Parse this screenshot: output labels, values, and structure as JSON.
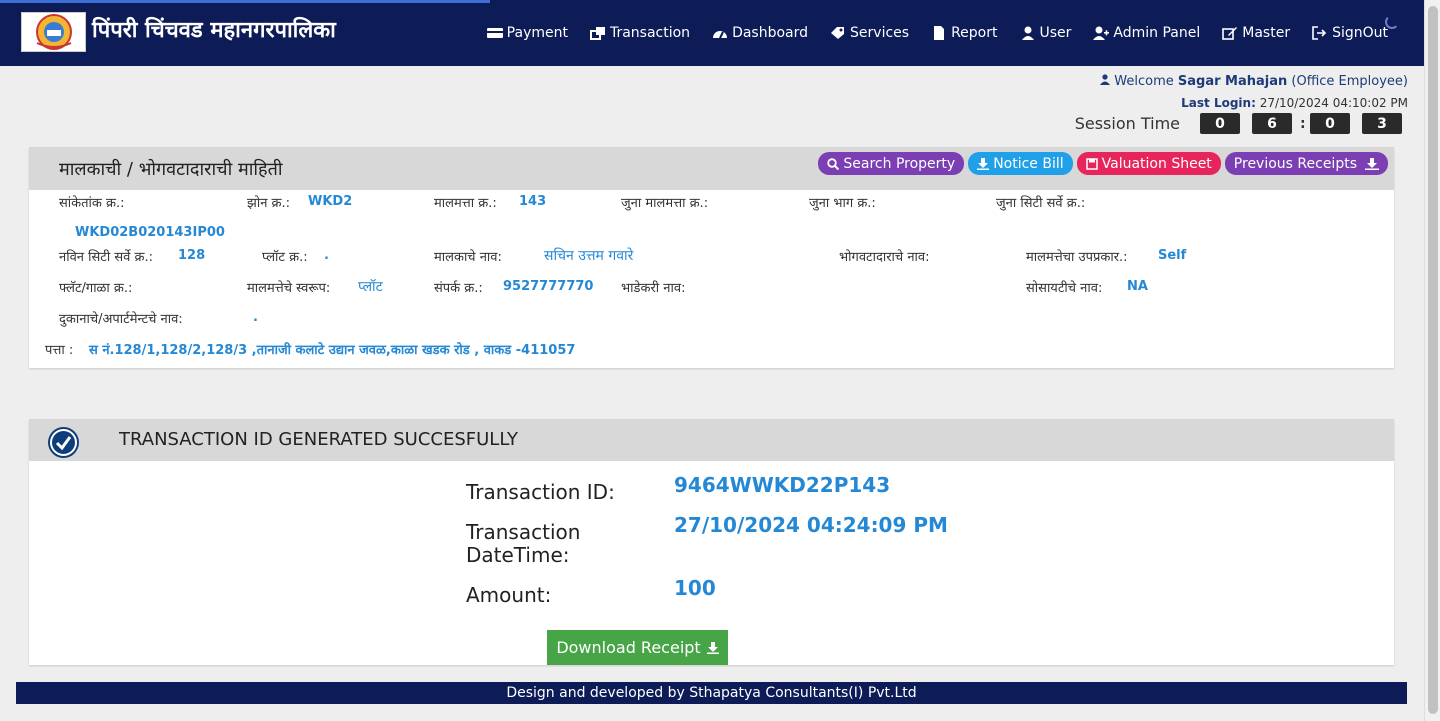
{
  "app": {
    "title": "पिंपरी चिंचवड महानगरपालिका",
    "logo": "pcmc-logo"
  },
  "nav": [
    {
      "label": "Payment",
      "icon": "card-icon"
    },
    {
      "label": "Transaction",
      "icon": "transfer-icon"
    },
    {
      "label": "Dashboard",
      "icon": "dashboard-icon"
    },
    {
      "label": "Services",
      "icon": "tag-icon"
    },
    {
      "label": "Report",
      "icon": "file-icon"
    },
    {
      "label": "User",
      "icon": "user-icon"
    },
    {
      "label": "Admin Panel",
      "icon": "user-plus-icon"
    },
    {
      "label": "Master",
      "icon": "edit-icon"
    },
    {
      "label": "SignOut",
      "icon": "signout-icon"
    }
  ],
  "user": {
    "welcome_prefix": "Welcome",
    "name": "Sagar Mahajan",
    "role": "(Office Employee)",
    "last_login_label": "Last Login:",
    "last_login_value": "27/10/2024 04:10:02 PM"
  },
  "session": {
    "label": "Session Time",
    "digits": [
      "0",
      "6",
      "0",
      "3"
    ]
  },
  "owner_panel": {
    "title": "मालकाची / भोगवटादाराची माहिती",
    "buttons": {
      "search": "Search Property",
      "notice": "Notice Bill",
      "valuation": "Valuation Sheet",
      "previous": "Previous Receipts"
    },
    "fields": {
      "sanketank_label": "सांकेतांक क्र.:",
      "sanketank_value": "WKD02B020143IP00",
      "zone_label": "झोन क्र.:",
      "zone_value": "WKD2",
      "malmatta_label": "मालमत्ता क्र.:",
      "malmatta_value": "143",
      "juna_malmatta_label": "जुना मालमत्ता क्र.:",
      "juna_bhag_label": "जुना भाग क्र.:",
      "juna_city_label": "जुना सिटी सर्वे क्र.:",
      "navin_city_label": "नविन सिटी सर्वे क्र.:",
      "navin_city_value": "128",
      "plot_label": "प्लॉट क्र.:",
      "plot_value": ".",
      "owner_name_label": "मालकाचे नाव:",
      "owner_name_value": "सचिन उत्तम गवारे",
      "occupant_label": "भोगवटादाराचे नाव:",
      "subtype_label": "मालमत्तेचा उपप्रकार.:",
      "subtype_value": "Self",
      "flat_label": "फ्लॅट/गाळा क्र.:",
      "nature_label": "मालमत्तेचे स्वरूप:",
      "nature_value": "प्लॉट",
      "contact_label": "संपर्क क्र.:",
      "contact_value": "9527777770",
      "tenant_label": "भाडेकरी नाव:",
      "society_label": "सोसायटीचे नाव:",
      "society_value": "NA",
      "shop_label": "दुकानाचे/अपार्टमेन्टचे नाव:",
      "shop_value": ".",
      "address_label": "पत्ता :",
      "address_value": "स नं.128/1,128/2,128/3 ,तानाजी कलाटे उद्यान जवळ,काळा खडक रोड , वाकड -411057"
    }
  },
  "transaction_panel": {
    "title": "TRANSACTION ID GENERATED SUCCESFULLY",
    "id_label": "Transaction ID:",
    "id_value": "9464WWKD22P143",
    "datetime_label_1": "Transaction",
    "datetime_label_2": "DateTime:",
    "datetime_value": "27/10/2024 04:24:09 PM",
    "amount_label": "Amount:",
    "amount_value": "100",
    "download_label": "Download Receipt"
  },
  "footer": {
    "text": "Design and developed by Sthapatya Consultants(I) Pvt.Ltd"
  }
}
